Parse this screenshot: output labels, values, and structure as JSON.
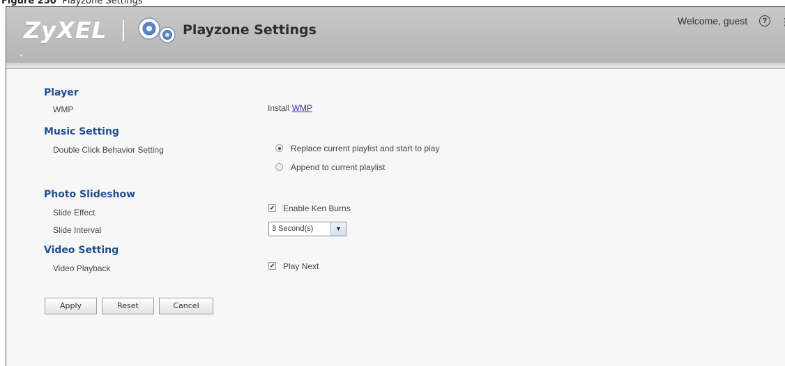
{
  "caption": {
    "figure_label": "Figure 250",
    "text": "Playzone Settings"
  },
  "header": {
    "brand": "ZyXEL",
    "app_title": "Playzone Settings",
    "welcome": "Welcome, guest",
    "help_icon": "?",
    "icons": [
      "gear-icon",
      "help-icon"
    ]
  },
  "sections": {
    "player": {
      "title": "Player",
      "wmp_label": "WMP",
      "install_text": "Install",
      "install_link": "WMP"
    },
    "music": {
      "title": "Music Setting",
      "double_click_label": "Double Click Behavior Setting",
      "options": [
        {
          "label": "Replace current playlist and start to play",
          "selected": true
        },
        {
          "label": "Append to current playlist",
          "selected": false
        }
      ]
    },
    "photo": {
      "title": "Photo Slideshow",
      "slide_effect_label": "Slide Effect",
      "ken_burns_label": "Enable Ken Burns",
      "ken_burns_checked": true,
      "slide_interval_label": "Slide Interval",
      "slide_interval_value": "3 Second(s)"
    },
    "video": {
      "title": "Video Setting",
      "playback_label": "Video Playback",
      "play_next_label": "Play Next",
      "play_next_checked": true
    }
  },
  "buttons": {
    "apply": "Apply",
    "reset": "Reset",
    "cancel": "Cancel"
  },
  "colors": {
    "section_title": "#1f4f8f",
    "header_bg": "#bcbcbc",
    "link": "#3b2aa8"
  }
}
